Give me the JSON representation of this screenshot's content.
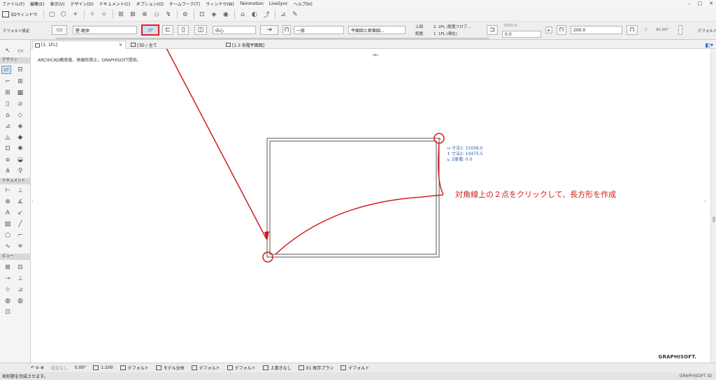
{
  "menu": [
    "ファイル(F)",
    "編集(E)",
    "表示(V)",
    "デザイン(D)",
    "ドキュメント(C)",
    "オプション(O)",
    "チームワーク(T)",
    "ウィンドウ(W)",
    "Twinmotion",
    "LiveSync",
    "ヘルプ(H)"
  ],
  "window_controls": [
    "–",
    "□",
    "✕"
  ],
  "std_toolbar": {
    "win3d_label": "3Dウィンドウ"
  },
  "infobox": {
    "default_label": "デフォルト設定",
    "layer": "壁-躯体",
    "ref_line": "中心",
    "composite": "一般",
    "structure_view": "平面図と断面図...",
    "top_label": "上部:",
    "top_value": "2. 2FL (配置フロア...",
    "home_label": "配置:",
    "home_value": "1. 1FL (現在)",
    "height": "3000.0",
    "offset": "0.0",
    "thickness": "200.0",
    "angle": "90.00°",
    "right_panel": "デフォルト"
  },
  "toolbox": {
    "design_header": "デザイン",
    "document_header": "ドキュメント",
    "view_header": "ビュー"
  },
  "tabs": [
    {
      "label": "[1. 1FL]",
      "close": "×"
    },
    {
      "label": "[3D / 全て]"
    },
    {
      "label": "[1.3 各階平面図]"
    }
  ],
  "canvas": {
    "credit": "ARCHICAD教育版、再頒布禁止。GRAPHISOFT提供。",
    "logo": "GRAPHISOFT.",
    "tracker": [
      "↔ 寸法1: 15036.0",
      "↕ 寸法2: 10475.5",
      "⊾ 2度増: 0.0"
    ],
    "annotation": "対角線上の２点をクリックして、長方形を作成"
  },
  "bottom_bar": [
    "設定なし",
    "0.00°",
    "1:100",
    "デフォルト",
    "モデル全体",
    "デフォルト",
    "デフォルト",
    "上書きなし",
    "01 既存プラン",
    "デフォルト"
  ],
  "status": {
    "left": "矩形壁を完成させます。",
    "right": "GRAPHISOFT ID"
  },
  "colors": {
    "annotation_red": "#d21c1c",
    "tracker_blue": "#2b5fa8",
    "selection_blue": "#cfe0f2"
  }
}
